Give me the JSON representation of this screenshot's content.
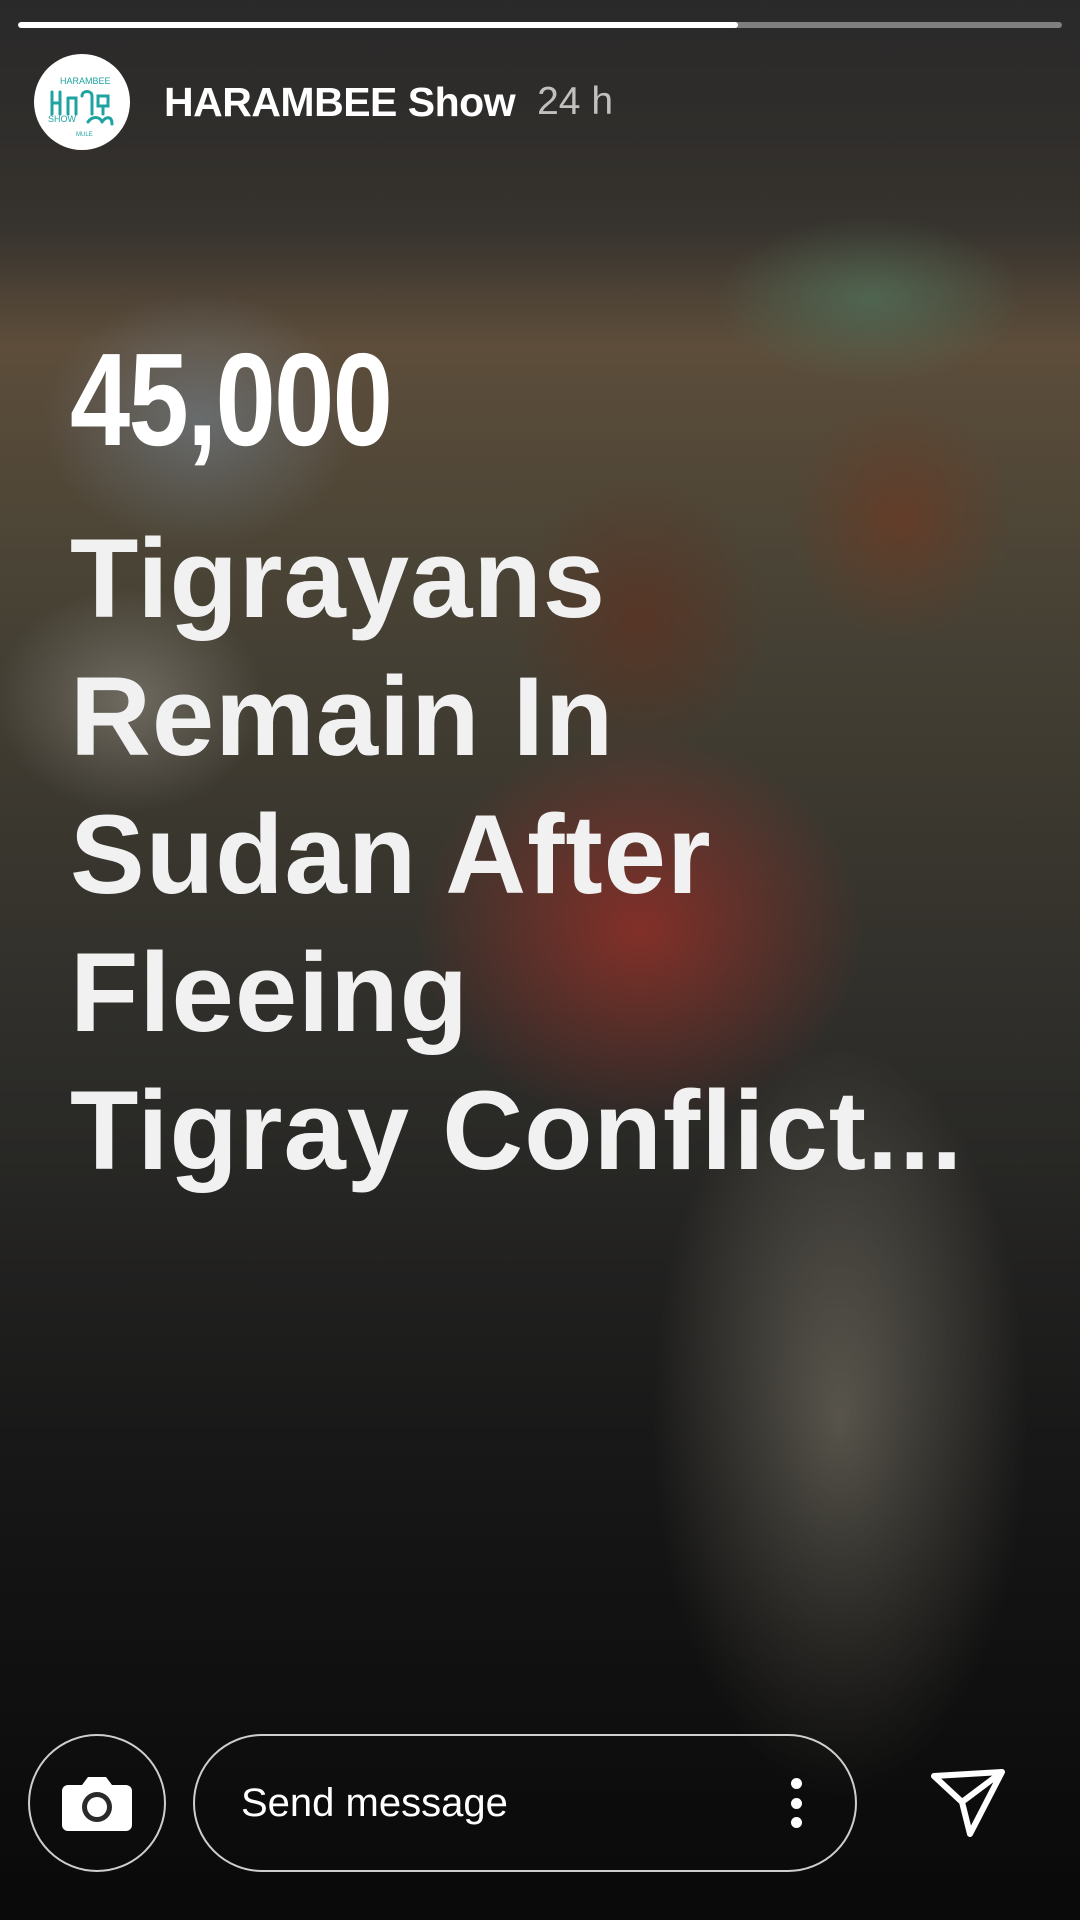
{
  "story": {
    "progress": 0.69,
    "progress_colors": {
      "fill": "#ffffff",
      "track": "rgba(255,255,255,0.4)"
    }
  },
  "header": {
    "account_name": "HARAMBEE Show",
    "timestamp": "24 h",
    "avatar": {
      "brand_color": "#1fa3a0",
      "logo_text": [
        "HARAMBEE",
        "SHOW",
        "MULE"
      ]
    }
  },
  "headline": {
    "number": "45,000",
    "lines": [
      "Tigrayans",
      "Remain In",
      "Sudan After",
      "Fleeing",
      "Tigray Conflict..."
    ]
  },
  "footer": {
    "message_placeholder": "Send message",
    "camera_icon": "camera-icon",
    "more_icon": "more-vertical-icon",
    "send_icon": "send-icon"
  }
}
